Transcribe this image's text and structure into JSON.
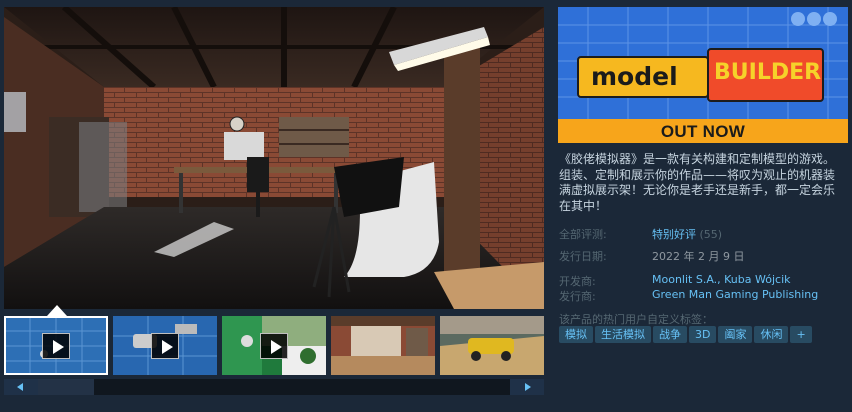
{
  "capsule": {
    "logo_left": "model",
    "logo_right": "BUILDER",
    "banner": "OUT NOW"
  },
  "description": "《胶佬模拟器》是一款有关构建和定制模型的游戏。组装、定制和展示你的作品——将叹为观止的机器装满虚拟展示架！无论你是老手还是新手，都一定会乐在其中！",
  "reviews": {
    "label": "全部评测:",
    "summary": "特别好评",
    "count": "(55)"
  },
  "release": {
    "label": "发行日期:",
    "date": "2022 年 2 月 9 日"
  },
  "developer": {
    "label": "开发商:",
    "value": "Moonlit S.A., Kuba Wójcik"
  },
  "publisher": {
    "label": "发行商:",
    "value": "Green Man Gaming Publishing"
  },
  "tags": {
    "label": "该产品的热门用户自定义标签：",
    "items": [
      "模拟",
      "生活模拟",
      "战争",
      "3D",
      "阖家",
      "休闲",
      "+"
    ]
  },
  "colors": {
    "background": "#1b2838",
    "link": "#66c0f4",
    "tag_bg": "#284b62",
    "banner": "#f7a51b"
  },
  "icons": {
    "thumbnail_video": "play-icon",
    "slider_left": "chevron-left-icon",
    "slider_right": "chevron-right-icon"
  }
}
